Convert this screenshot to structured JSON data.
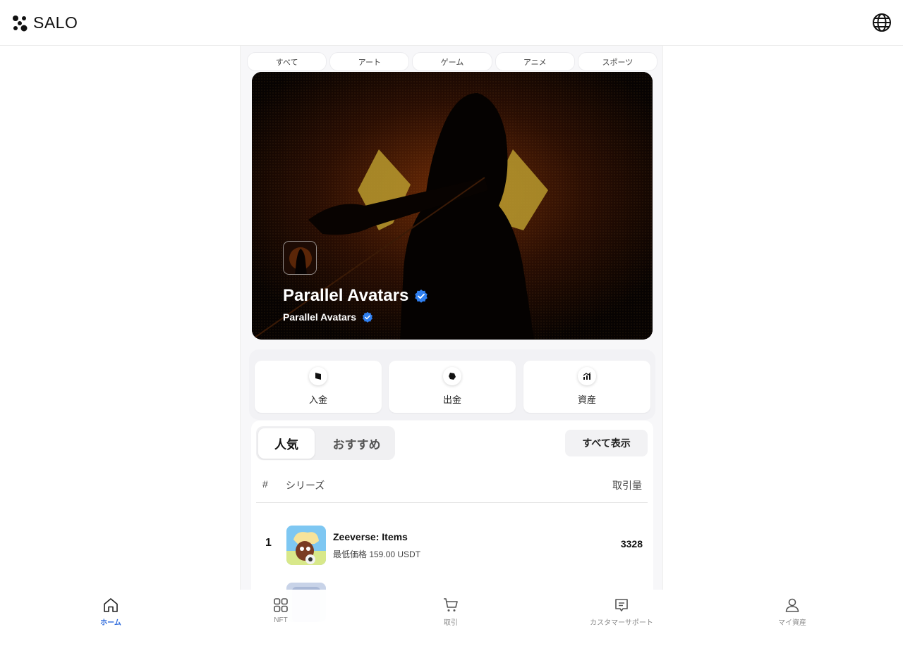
{
  "app": {
    "logo_text": "SALO",
    "colors": {
      "accent": "#2f6bdc",
      "verified": "#2f7ff0"
    }
  },
  "header": {
    "language_icon": "globe-icon"
  },
  "categories": [
    "すべて",
    "アート",
    "ゲーム",
    "アニメ",
    "スポーツ"
  ],
  "banner": {
    "title": "Parallel Avatars",
    "creator": "Parallel Avatars",
    "verified": true
  },
  "actions": [
    {
      "label": "入金",
      "icon": "deposit-icon"
    },
    {
      "label": "出金",
      "icon": "withdraw-icon"
    },
    {
      "label": "資産",
      "icon": "assets-chart-icon"
    }
  ],
  "ranking": {
    "tabs": [
      "人気",
      "おすすめ"
    ],
    "active_tab": "人気",
    "view_all_label": "すべて表示",
    "columns": {
      "rank": "#",
      "series": "シリーズ",
      "volume": "取引量"
    },
    "rows": [
      {
        "rank": "1",
        "name": "Zeeverse: Items",
        "price": "最低価格 159.00 USDT",
        "volume": "3328"
      }
    ]
  },
  "bottom_nav": [
    {
      "label": "ホーム",
      "icon": "home-icon",
      "active": true
    },
    {
      "label": "NFT",
      "icon": "grid-icon",
      "active": false
    },
    {
      "label": "取引",
      "icon": "cart-icon",
      "active": false
    },
    {
      "label": "カスタマーサポート",
      "icon": "chat-icon",
      "active": false
    },
    {
      "label": "マイ資産",
      "icon": "user-icon",
      "active": false
    }
  ]
}
